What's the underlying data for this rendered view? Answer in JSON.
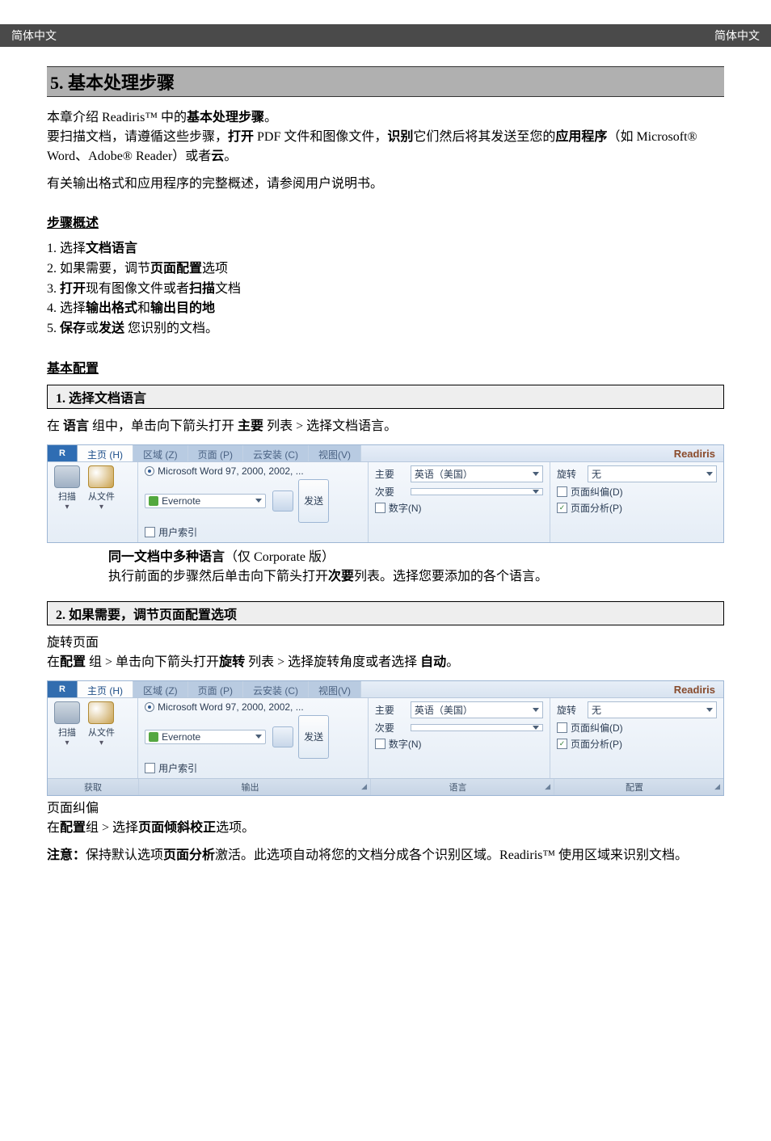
{
  "header": {
    "left": "简体中文",
    "right": "简体中文"
  },
  "section_title": "5. 基本处理步骤",
  "intro": {
    "l1_a": "本章介绍 Readiris™ 中的",
    "l1_b": "基本处理步骤",
    "l1_c": "。",
    "l2_a": "要扫描文档，请遵循这些步骤，",
    "l2_b": "打开",
    "l2_c": " PDF 文件和图像文件，",
    "l2_d": "识别",
    "l2_e": "它们然后将其发送至您的",
    "l2_f": "应用程序",
    "l2_g": "（如 Microsoft® Word、Adobe® Reader）或者",
    "l2_h": "云",
    "l2_i": "。",
    "l3": "有关输出格式和应用程序的完整概述，请参阅用户说明书。"
  },
  "steps_overview_heading": "步骤概述",
  "steps": {
    "s1_a": "1. 选择",
    "s1_b": "文档语言",
    "s2_a": "2. 如果需要，调节",
    "s2_b": "页面配置",
    "s2_c": "选项",
    "s3_a": "3. ",
    "s3_b": "打开",
    "s3_c": "现有图像文件或者",
    "s3_d": "扫描",
    "s3_e": "文档",
    "s4_a": "4. 选择",
    "s4_b": "输出格式",
    "s4_c": "和",
    "s4_d": "输出目的地",
    "s5_a": "5. ",
    "s5_b": "保存",
    "s5_c": "或",
    "s5_d": "发送",
    "s5_e": " 您识别的文档。"
  },
  "basic_config_heading": "基本配置",
  "bar1": "1. 选择文档语言",
  "bar1_text_a": "在 ",
  "bar1_text_b": "语言",
  "bar1_text_c": " 组中，单击向下箭头打开 ",
  "bar1_text_d": "主要",
  "bar1_text_e": " 列表 > 选择文档语言。",
  "ribbon": {
    "app_title": "Readiris",
    "logo": "R",
    "tabs": {
      "home": "主页 (H)",
      "zone": "区域 (Z)",
      "page": "页面 (P)",
      "cloud": "云安装 (C)",
      "view": "视图(V)"
    },
    "acquire": {
      "scan": "扫描",
      "fromfile": "从文件",
      "drop": "▾"
    },
    "output": {
      "radio_word": "Microsoft Word 97, 2000, 2002, ...",
      "evernote": "Evernote",
      "user_index": "用户索引",
      "send": "发送"
    },
    "language": {
      "primary_label": "主要",
      "primary_value": "英语（美国）",
      "secondary_label": "次要",
      "numeric": "数字(N)"
    },
    "config": {
      "rotate_label": "旋转",
      "rotate_value": "无",
      "deskew": "页面纠偏(D)",
      "analysis": "页面分析(P)"
    },
    "captions": {
      "acquire": "获取",
      "output": "输出",
      "language": "语言",
      "config": "配置"
    }
  },
  "multi_lang": {
    "l1_a": "同一文档中多种语言",
    "l1_b": "（仅 Corporate 版）",
    "l2_a": "执行前面的步骤然后单击向下箭头打开",
    "l2_b": "次要",
    "l2_c": "列表。选择您要添加的各个语言。"
  },
  "bar2": "2. 如果需要，调节页面配置选项",
  "rotate_block": {
    "title": "旋转页面",
    "l_a": "在",
    "l_b": "配置",
    "l_c": " 组 > 单击向下箭头打开",
    "l_d": "旋转",
    "l_e": " 列表 > 选择旋转角度或者选择 ",
    "l_f": "自动",
    "l_g": "。"
  },
  "deskew_block": {
    "title": "页面纠偏",
    "l_a": "在",
    "l_b": "配置",
    "l_c": "组 > 选择",
    "l_d": "页面倾斜校正",
    "l_e": "选项。"
  },
  "note_block": {
    "a": "注意：",
    "b": "保持默认选项",
    "c": "页面分析",
    "d": "激活。此选项自动将您的文档分成各个识别区域。Readiris™ 使用区域来识别文档。"
  }
}
